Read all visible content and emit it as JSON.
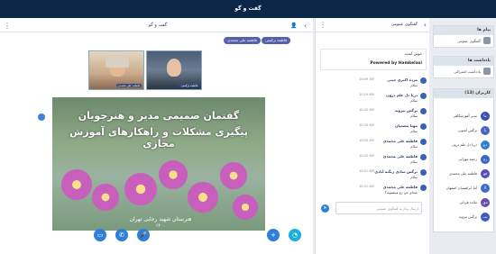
{
  "app": {
    "title": "گفت و گو"
  },
  "center": {
    "title": "گفت و گو",
    "presenters": [
      {
        "name": "فاطمه علی محمدی"
      },
      {
        "name": "فاطمه ترکمنی"
      }
    ],
    "cams": [
      {
        "name": "فاطمه علی محمدی"
      },
      {
        "name": "فاطمه ترکمنی"
      }
    ],
    "slide": {
      "heading1": "گفتمان صمیمی مدیر و هنرجویان",
      "heading2": "پیگیری مشکلات و راهکارهای آموزش مجازی",
      "footer1": "هنرستان شهید رجایی تهران",
      "footer2": "۱۴۰۰"
    }
  },
  "chat": {
    "title": "گفتگوی عمومی",
    "welcome_line": "خوش آمدید",
    "powered": "Powered by Hamkelasi",
    "messages": [
      {
        "name": "مژده اکبری چیتی",
        "time": "10:09 AM",
        "text": "سلام"
      },
      {
        "name": "دریا دل علم درون",
        "time": "10:19 AM",
        "text": "سلام"
      },
      {
        "name": "نرگس تیزوند",
        "time": "10:20 AM",
        "text": "سلام"
      },
      {
        "name": "مهتا مشغیان",
        "time": "10:20 AM",
        "text": "سلام"
      },
      {
        "name": "فاطمه علی محمدی",
        "time": "10:20 AM",
        "text": "سلام"
      },
      {
        "name": "فاطمه علی محمدی",
        "time": "10:20 AM",
        "text": "سلام"
      },
      {
        "name": "نرگس سادی زنگنه آبادی",
        "time": "10:21 AM",
        "text": "سلام"
      },
      {
        "name": "فاطمه علی محمدی",
        "time": "10:21 AM",
        "text": "صدای من رو میشنوید؟"
      }
    ],
    "input_placeholder": "ارسال پیام به گفتگوی عمومی"
  },
  "sidebar": {
    "messages_header": "پیام ها",
    "messages_items": [
      {
        "label": "گفتگوی عمومی"
      }
    ],
    "notes_header": "یادداشت ها",
    "notes_items": [
      {
        "label": "یادداشت اشتراکی"
      }
    ],
    "users_header": "کاربران (13)",
    "users": [
      {
        "name": "مدیر آموزشگاهی",
        "initials": "مآ",
        "color": "#3a4fb0"
      },
      {
        "name": "نرگس آشوبی",
        "initials": "نآ",
        "color": "#4a64c4"
      },
      {
        "name": "دریا دل علم درون",
        "initials": "دع",
        "color": "#2f7fd6"
      },
      {
        "name": "رحمه مهرانی",
        "initials": "رم",
        "color": "#3864c8"
      },
      {
        "name": "فاطمه علی محمدی",
        "initials": "فع",
        "color": "#5a4cbd"
      },
      {
        "name": "آتنا ابراهیمیان اصفهان",
        "initials": "آا",
        "color": "#3b6dd0"
      },
      {
        "name": "مائده قربانی",
        "initials": "مق",
        "color": "#6a4bb3"
      },
      {
        "name": "نرگس تیزوند",
        "initials": "نت",
        "color": "#3a5ec0"
      }
    ]
  }
}
